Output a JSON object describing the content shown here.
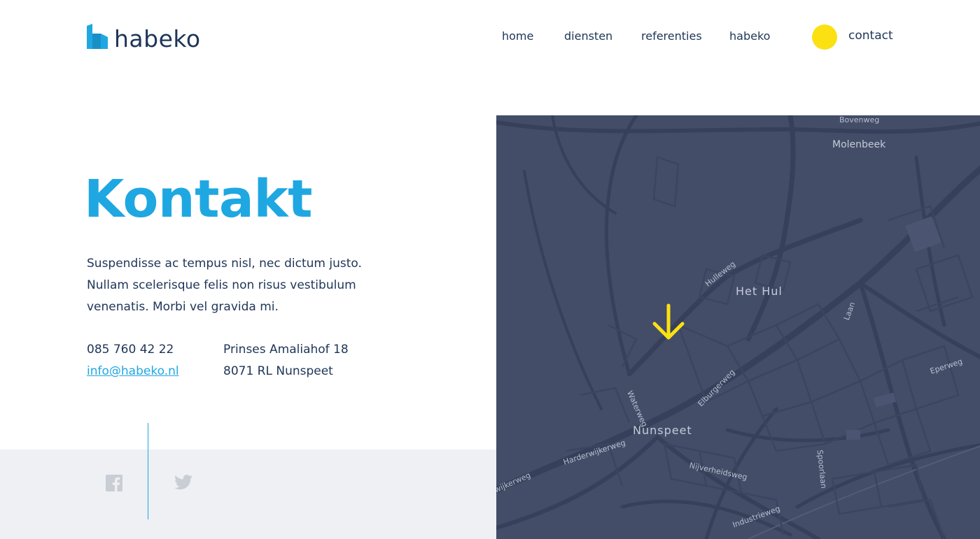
{
  "header": {
    "logo_text": "habeko",
    "logo_icon": "habeko-logo-mark",
    "nav": [
      {
        "label": "home"
      },
      {
        "label": "diensten"
      },
      {
        "label": "referenties"
      },
      {
        "label": "habeko"
      },
      {
        "label": "contact"
      }
    ]
  },
  "main": {
    "title": "Kontakt",
    "intro_lines": [
      "Suspendisse ac tempus nisl, nec dictum justo.",
      "Nullam scelerisque felis non risus vestibulum",
      "venenatis. Morbi vel gravida mi."
    ],
    "phone": "085 760 42 22",
    "email": "info@habeko.nl",
    "address_street": "Prinses Amaliahof 18",
    "address_city": "8071 RL Nunspeet"
  },
  "footer": {
    "social": [
      {
        "icon": "facebook-icon"
      },
      {
        "icon": "twitter-icon"
      }
    ]
  },
  "map": {
    "labels": {
      "bovenweg": "Bovenweg",
      "molenbeek": "Molenbeek",
      "hulleweg": "Hulleweg",
      "het_hul": "Het Hul",
      "laan": "Laan",
      "eperweg": "Eperweg",
      "elburgerweg": "Elburgerweg",
      "waterweg": "Waterweg",
      "nunspeet": "Nunspeet",
      "harderwijkerweg": "Harderwijkerweg",
      "wijkerweg": "wijkerweg",
      "nijverheidsweg": "Nijverheidsweg",
      "spoorlaan": "Spoorlaan",
      "industrieweg": "Industrieweg"
    },
    "marker_icon": "location-arrow-icon"
  },
  "colors": {
    "accent_blue": "#1fa7e2",
    "navy_text": "#1e3557",
    "yellow": "#fbe112",
    "map_bg": "#434d68",
    "footer_bg": "#eef0f3"
  }
}
